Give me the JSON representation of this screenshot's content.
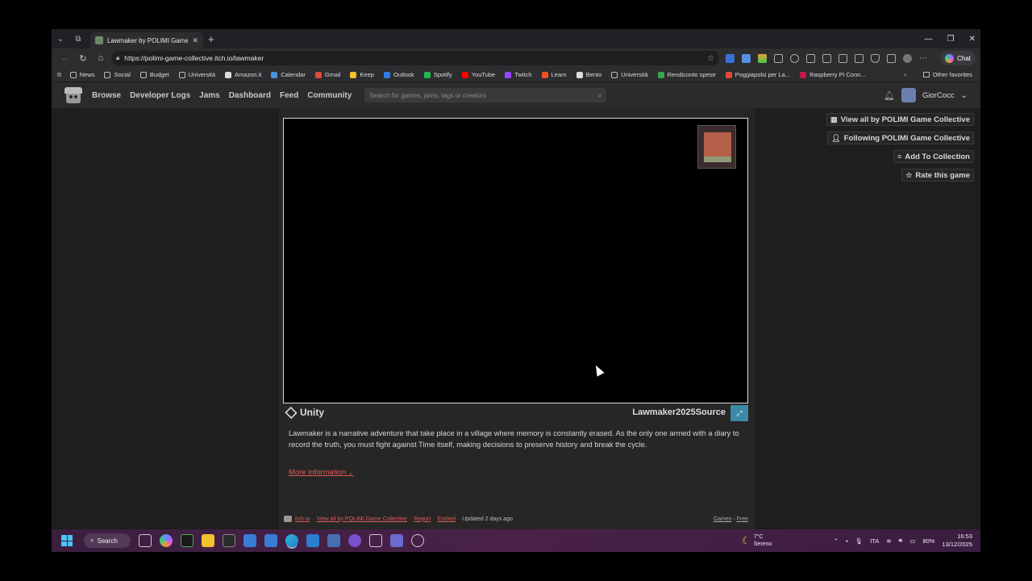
{
  "browser": {
    "tab_title": "Lawmaker by POLIMI Game Collec",
    "url": "https://polimi-game-collective.itch.io/lawmaker",
    "chat_label": "Chat"
  },
  "favorites": [
    {
      "label": "News",
      "color": "#bbbbbb"
    },
    {
      "label": "Social",
      "color": "#bbbbbb"
    },
    {
      "label": "Budget",
      "color": "#bbbbbb"
    },
    {
      "label": "Università",
      "color": "#bbbbbb"
    },
    {
      "label": "Amazon.it",
      "color": "#dddddd"
    },
    {
      "label": "Calendar",
      "color": "#4a90d9"
    },
    {
      "label": "Gmail",
      "color": "#e04a3a"
    },
    {
      "label": "Keep",
      "color": "#f2c12e"
    },
    {
      "label": "Outlook",
      "color": "#2f7de1"
    },
    {
      "label": "Spotify",
      "color": "#1db954"
    },
    {
      "label": "YouTube",
      "color": "#ff0000"
    },
    {
      "label": "Twitch",
      "color": "#9146ff"
    },
    {
      "label": "Learn",
      "color": "#f25022"
    },
    {
      "label": "Bento",
      "color": "#dddddd"
    },
    {
      "label": "Università",
      "color": "#bbbbbb"
    },
    {
      "label": "Rendiconto spese",
      "color": "#34a853"
    },
    {
      "label": "Poggiapolsi per La...",
      "color": "#e04a3a"
    },
    {
      "label": "Raspberry Pi Conn...",
      "color": "#c51a4a"
    }
  ],
  "favorites_other": "Other favorites",
  "itch": {
    "nav": [
      "Browse",
      "Developer Logs",
      "Jams",
      "Dashboard",
      "Feed",
      "Community"
    ],
    "search_placeholder": "Search for games, jams, tags or creators",
    "username": "GiorCocc"
  },
  "game": {
    "engine": "Unity",
    "name": "Lawmaker2025Source",
    "description": "Lawmaker is a narrative adventure that take place in a village where memory is constantly erased. As the only one armed with a diary to record the truth, you must fight against Time itself, making decisions to preserve history and break the cycle.",
    "more_info": "More information"
  },
  "side_actions": [
    {
      "label": "View all by POLIMI Game Collective",
      "icon": "store-icon"
    },
    {
      "label": "Following POLIMI Game Collective",
      "icon": "user-follow-icon"
    },
    {
      "label": "Add To Collection",
      "icon": "collection-icon"
    },
    {
      "label": "Rate this game",
      "icon": "star-icon"
    }
  ],
  "footer": {
    "itchio": "itch.io",
    "view_all": "View all by POLIMI Game Collective",
    "report": "Report",
    "embed": "Embed",
    "updated": "Updated 2 days ago",
    "games": "Games",
    "free": "Free"
  },
  "taskbar": {
    "search": "Search",
    "temp": "7°C",
    "weather": "Sereno",
    "lang": "ITA",
    "battery": "80%",
    "time": "16:53",
    "date": "13/12/2025"
  }
}
